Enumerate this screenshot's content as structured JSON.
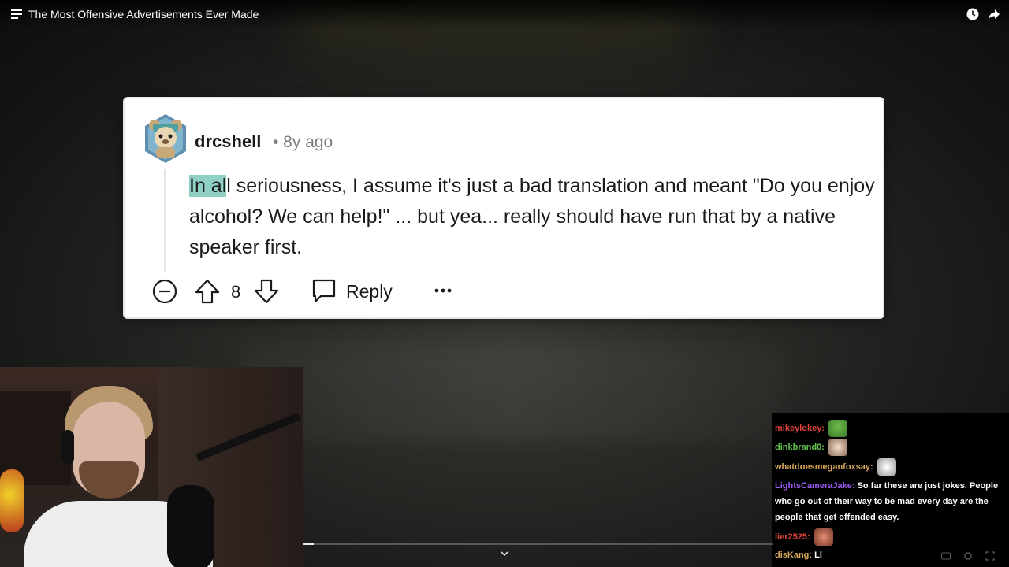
{
  "header": {
    "title": "The Most Offensive Advertisements Ever Made",
    "icons": [
      "menu-icon",
      "clock-icon",
      "share-icon"
    ]
  },
  "comment": {
    "username": "drcshell",
    "meta": "• 8y ago",
    "body_highlight": "In al",
    "body_rest": "l seriousness, I assume it's just a bad translation and meant \"Do you enjoy alcohol? We can help!\" ... but yea... really should have run that by a native speaker first.",
    "score": "8",
    "reply_label": "Reply",
    "highlight_color": "#8fd0c4"
  },
  "chat": {
    "messages": [
      {
        "user": "mikeylokey:",
        "color": "#e0423b",
        "text": "",
        "emote": "pepe-emote"
      },
      {
        "user": "dinkbrand0:",
        "color": "#63c44f",
        "text": "",
        "emote": "face-emote"
      },
      {
        "user": "whatdoesmeganfoxsay:",
        "color": "#d9a85a",
        "text": "",
        "emote": "horse-emote"
      },
      {
        "user": "LightsCameraJake:",
        "color": "#9a5cf0",
        "text": "So far these are just jokes. People who go out of their way to be mad every day are the people that get offended easy.",
        "emote": ""
      },
      {
        "user": "lier2525:",
        "color": "#e0423b",
        "text": "",
        "emote": "face-emote"
      },
      {
        "user": "disKang:",
        "color": "#d9a85a",
        "text": "Ll",
        "emote": ""
      }
    ]
  },
  "player": {
    "progress": 0.023
  }
}
